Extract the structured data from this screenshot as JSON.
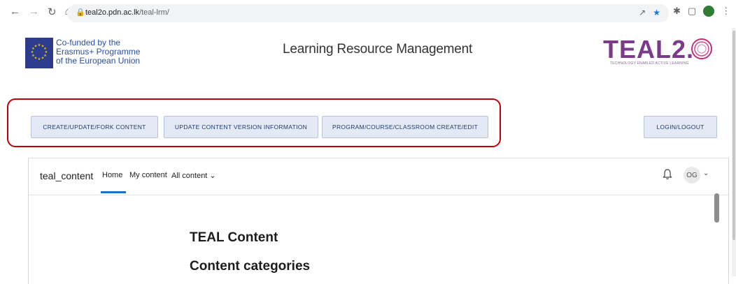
{
  "browser": {
    "back_icon": "arrow-left-icon",
    "forward_icon": "arrow-right-icon",
    "reload_icon": "reload-icon",
    "home_icon": "home-icon",
    "url_host": "teal2o.pdn.ac.lk",
    "url_path": "/teal-lrm/"
  },
  "header": {
    "eu_lines": [
      "Co-funded by the",
      "Erasmus+ Programme",
      "of the European Union"
    ],
    "title": "Learning Resource Management",
    "logo_text": "TEAL2.",
    "logo_tagline": "TECHNOLOGY ENABLED ACTIVE LEARNING"
  },
  "actions": {
    "create": "CREATE/UPDATE/FORK CONTENT",
    "update_version": "UPDATE CONTENT VERSION INFORMATION",
    "program": "PROGRAM/COURSE/CLASSROOM CREATE/EDIT",
    "login": "LOGIN/LOGOUT"
  },
  "panel": {
    "brand": "teal_content",
    "nav": [
      "Home",
      "My content",
      "All content ⌄"
    ],
    "avatar": "OG",
    "heading": "TEAL Content",
    "subheading": "Content categories"
  },
  "colors": {
    "highlight": "#c00000",
    "button_bg": "#e3eaf6",
    "logo_purple": "#7b3a8a",
    "active_underline": "#1f6fc5"
  }
}
